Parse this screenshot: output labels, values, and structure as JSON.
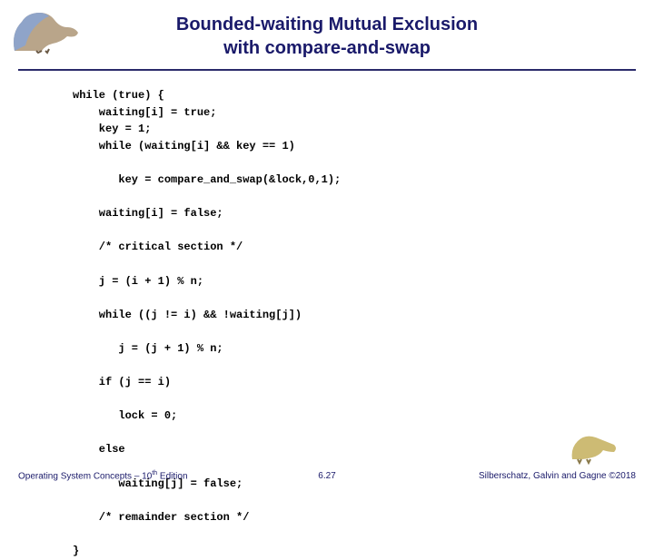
{
  "header": {
    "title_line1": "Bounded-waiting Mutual Exclusion",
    "title_line2": "with compare-and-swap"
  },
  "code": {
    "l1": "while (true) {",
    "l2": "    waiting[i] = true;",
    "l3": "    key = 1;",
    "l4": "    while (waiting[i] && key == 1)",
    "l5": "       key = compare_and_swap(&lock,0,1);",
    "l6": "    waiting[i] = false;",
    "l7": "    /* critical section */",
    "l8": "    j = (i + 1) % n;",
    "l9": "    while ((j != i) && !waiting[j])",
    "l10": "       j = (j + 1) % n;",
    "l11": "    if (j == i)",
    "l12": "       lock = 0;",
    "l13": "    else",
    "l14": "       waiting[j] = false;",
    "l15": "    /* remainder section */",
    "l16": "}"
  },
  "footer": {
    "left_a": "Operating System Concepts – 10",
    "left_b": " Edition",
    "left_sup": "th",
    "center": "6.27",
    "right": "Silberschatz, Galvin and Gagne ©2018"
  }
}
